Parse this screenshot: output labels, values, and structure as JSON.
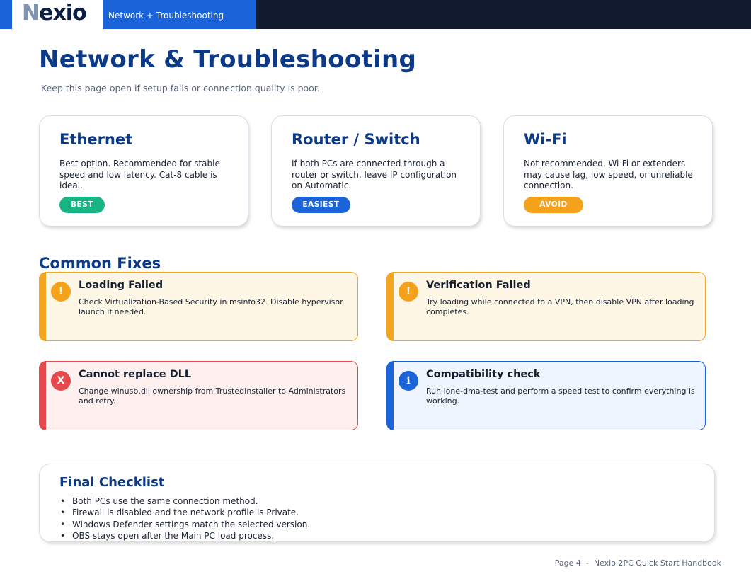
{
  "header": {
    "logo_initial": "N",
    "logo_rest": "exio",
    "section_label": "Network + Troubleshooting"
  },
  "page": {
    "title": "Network & Troubleshooting",
    "subtitle": "Keep this page open if setup fails or connection quality is poor."
  },
  "connection_cards": [
    {
      "title": "Ethernet",
      "description": "Best option. Recommended for stable speed and low latency. Cat-8 cable is ideal.",
      "tag": "BEST",
      "tag_color": "#19b483"
    },
    {
      "title": "Router / Switch",
      "description": "If both PCs are connected through a router or switch, leave IP configuration on Automatic.",
      "tag": "EASIEST",
      "tag_color": "#1a63d8"
    },
    {
      "title": "Wi-Fi",
      "description": "Not recommended. Wi-Fi or extenders may cause lag, low speed, or unreliable connection.",
      "tag": "AVOID",
      "tag_color": "#f4a11c"
    }
  ],
  "common_fixes": {
    "title": "Common Fixes",
    "items": [
      {
        "icon": "!",
        "severity": "warning",
        "title": "Loading Failed",
        "text": "Check Virtualization-Based Security in msinfo32. Disable hypervisor launch if needed."
      },
      {
        "icon": "!",
        "severity": "warning",
        "title": "Verification Failed",
        "text": "Try loading while connected to a VPN, then disable VPN after loading completes."
      },
      {
        "icon": "X",
        "severity": "error",
        "title": "Cannot replace DLL",
        "text": "Change winusb.dll ownership from TrustedInstaller to Administrators and retry."
      },
      {
        "icon": "i",
        "severity": "info",
        "title": "Compatibility check",
        "text": "Run lone-dma-test and perform a speed test to confirm everything is working."
      }
    ]
  },
  "final_checklist": {
    "title": "Final Checklist",
    "bullet": "•",
    "items": [
      "Both PCs use the same connection method.",
      "Firewall is disabled and the network profile is Private.",
      "Windows Defender settings match the selected version.",
      "OBS stays open after the Main PC load process."
    ]
  },
  "footer": {
    "text": "Page 4  -  Nexio 2PC Quick Start Handbook"
  },
  "colors": {
    "primary": "#0d3a86",
    "accent_blue": "#1a63d8",
    "top_bar": "#121a30",
    "warning": "#f4a11c",
    "error": "#e5484d",
    "success": "#19b483"
  }
}
